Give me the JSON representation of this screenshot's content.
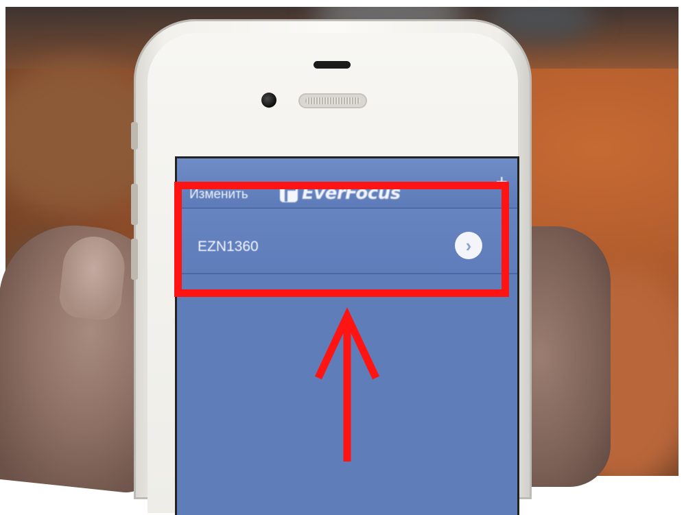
{
  "navbar": {
    "edit_label": "Изменить",
    "logo_text": "EverFocus",
    "add_label": "+"
  },
  "devices": [
    {
      "name": "EZN1360"
    }
  ],
  "annotation": {
    "box_color": "#ff1414",
    "arrow_color": "#ff1414",
    "arrow_direction": "up"
  },
  "icons": {
    "logo": "everfocus-logo-icon",
    "disclosure": "chevron-right-circle-icon",
    "add": "plus-icon"
  }
}
